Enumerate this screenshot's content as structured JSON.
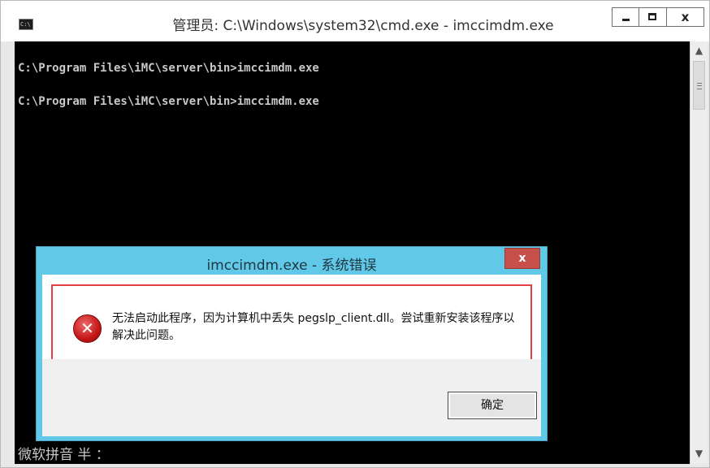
{
  "window": {
    "title": "管理员: C:\\Windows\\system32\\cmd.exe - imccimdm.exe",
    "icon": "cmd-icon",
    "close_glyph": "x"
  },
  "console": {
    "lines": [
      "C:\\Program Files\\iMC\\server\\bin>imccimdm.exe",
      "C:\\Program Files\\iMC\\server\\bin>imccimdm.exe"
    ],
    "ime_status": "微软拼音 半 ："
  },
  "scrollbar": {
    "up_arrow": "▲",
    "down_arrow": "▼"
  },
  "dialog": {
    "title": "imccimdm.exe - 系统错误",
    "close_label": "x",
    "icon": "error-icon",
    "icon_glyph": "✕",
    "message": "无法启动此程序，因为计算机中丢失 pegslp_client.dll。尝试重新安装该程序以解决此问题。",
    "ok_label": "确定",
    "highlight_color": "#e24141",
    "title_bar_color": "#62c8e8"
  }
}
